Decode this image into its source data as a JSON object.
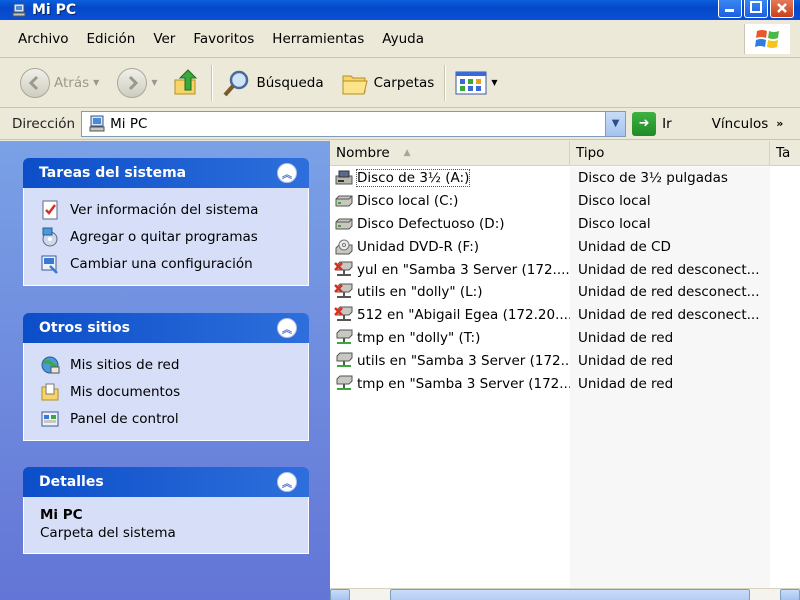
{
  "window": {
    "title": "Mi PC"
  },
  "menubar": {
    "items": [
      "Archivo",
      "Edición",
      "Ver",
      "Favoritos",
      "Herramientas",
      "Ayuda"
    ]
  },
  "toolbar": {
    "back_label": "Atrás",
    "search_label": "Búsqueda",
    "folders_label": "Carpetas"
  },
  "addressbar": {
    "label": "Dirección",
    "value": "Mi PC",
    "go_label": "Ir",
    "links_label": "Vínculos"
  },
  "taskpane": {
    "system_tasks": {
      "title": "Tareas del sistema",
      "items": [
        {
          "label": "Ver información del sistema",
          "icon": "system-info-icon"
        },
        {
          "label": "Agregar o quitar programas",
          "icon": "add-remove-programs-icon"
        },
        {
          "label": "Cambiar una configuración",
          "icon": "control-panel-settings-icon"
        }
      ]
    },
    "other_places": {
      "title": "Otros sitios",
      "items": [
        {
          "label": "Mis sitios de red",
          "icon": "network-places-icon"
        },
        {
          "label": "Mis documentos",
          "icon": "my-documents-icon"
        },
        {
          "label": "Panel de control",
          "icon": "control-panel-icon"
        }
      ]
    },
    "details": {
      "title": "Detalles",
      "name": "Mi PC",
      "type": "Carpeta del sistema"
    }
  },
  "filelist": {
    "columns": [
      "Nombre",
      "Tipo",
      "Ta"
    ],
    "rows": [
      {
        "name": "Disco de 3½ (A:)",
        "type": "Disco de 3½ pulgadas",
        "icon": "floppy-drive-icon"
      },
      {
        "name": "Disco local (C:)",
        "type": "Disco local",
        "icon": "hard-drive-icon"
      },
      {
        "name": "Disco Defectuoso (D:)",
        "type": "Disco local",
        "icon": "hard-drive-icon"
      },
      {
        "name": "Unidad DVD-R (F:)",
        "type": "Unidad de CD",
        "icon": "dvd-drive-icon"
      },
      {
        "name": "yul en \"Samba 3 Server (172....",
        "type": "Unidad de red desconect...",
        "icon": "network-drive-disconnected-icon"
      },
      {
        "name": "utils en \"dolly\" (L:)",
        "type": "Unidad de red desconect...",
        "icon": "network-drive-disconnected-icon"
      },
      {
        "name": "512 en \"Abigail Egea (172.20....",
        "type": "Unidad de red desconect...",
        "icon": "network-drive-disconnected-icon"
      },
      {
        "name": "tmp en \"dolly\" (T:)",
        "type": "Unidad de red",
        "icon": "network-drive-icon"
      },
      {
        "name": "utils en \"Samba 3 Server (172...",
        "type": "Unidad de red",
        "icon": "network-drive-icon"
      },
      {
        "name": "tmp en \"Samba 3 Server (172....",
        "type": "Unidad de red",
        "icon": "network-drive-icon"
      }
    ]
  },
  "colors": {
    "titlebar": "#0548c9",
    "taskpane_bg": "#6f8fe0",
    "panel_title": "#215dc6",
    "panel_body": "#d6dff7"
  }
}
